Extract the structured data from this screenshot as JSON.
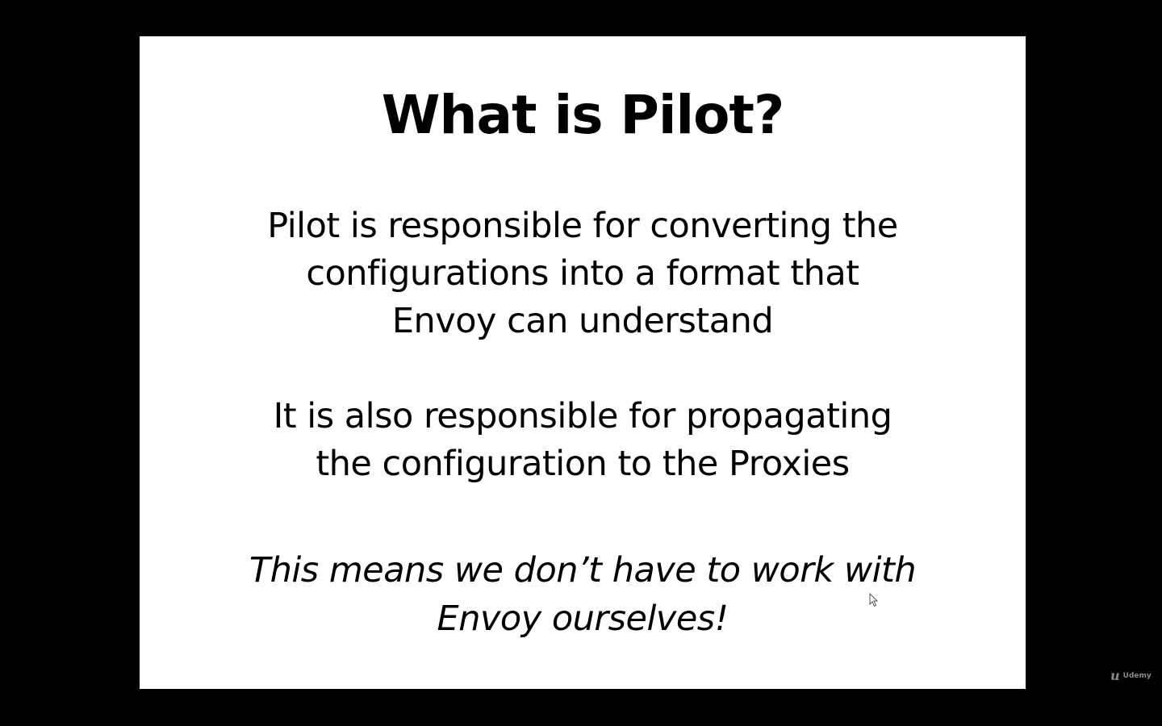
{
  "slide": {
    "title": "What is Pilot?",
    "paragraphs": [
      {
        "lines": [
          "Pilot is responsible for converting the",
          "configurations into a format that",
          "Envoy can understand"
        ]
      },
      {
        "lines": [
          "It is also responsible for propagating",
          "the configuration to the Proxies"
        ]
      },
      {
        "lines": [
          "This means we don’t have to work with",
          "Envoy ourselves!"
        ]
      }
    ]
  },
  "watermark": {
    "logo": "u",
    "text": "Udemy"
  }
}
